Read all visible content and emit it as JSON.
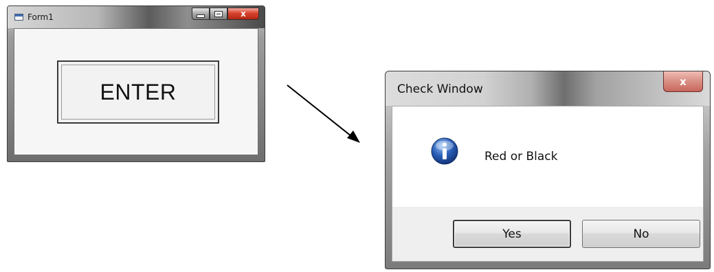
{
  "form1": {
    "title": "Form1",
    "icon": "form-window-icon",
    "controls": {
      "minimize_icon": "minimize-icon",
      "maximize_icon": "maximize-icon",
      "close_label": "x"
    },
    "enter_button_label": "ENTER"
  },
  "arrow": {
    "icon": "arrow-icon"
  },
  "dialog": {
    "title": "Check Window",
    "close_label": "x",
    "icon": "info-icon",
    "message": "Red or Black",
    "buttons": {
      "yes": "Yes",
      "no": "No"
    }
  },
  "colors": {
    "close_red": "#d8442e",
    "info_blue": "#2a5fb8"
  }
}
